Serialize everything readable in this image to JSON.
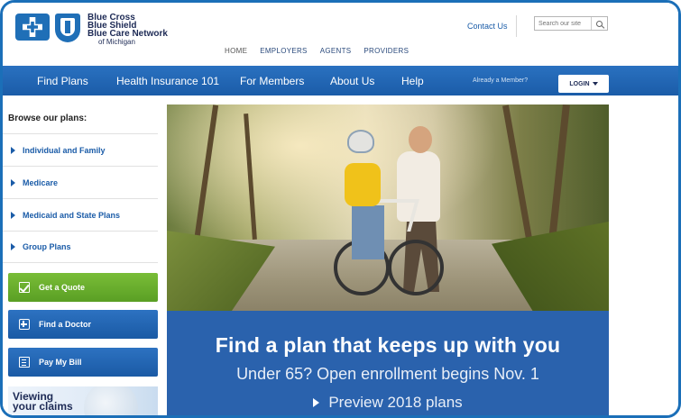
{
  "header": {
    "logo_lines": [
      "Blue Cross",
      "Blue Shield",
      "Blue Care Network"
    ],
    "logo_sub": "of Michigan",
    "contact_label": "Contact Us",
    "search_placeholder": "Search our site"
  },
  "topnav": [
    "HOME",
    "EMPLOYERS",
    "AGENTS",
    "PROVIDERS"
  ],
  "mainnav": {
    "items": [
      "Find Plans",
      "Health Insurance 101",
      "For Members",
      "About Us",
      "Help"
    ],
    "member_text": "Already a Member?",
    "login_label": "LOGIN"
  },
  "sidebar": {
    "title": "Browse our plans:",
    "items": [
      "Individual and Family",
      "Medicare",
      "Medicaid and State Plans",
      "Group Plans"
    ],
    "buttons": {
      "quote": "Get a Quote",
      "doctor": "Find a Doctor",
      "bill": "Pay My Bill"
    },
    "claims": [
      "Viewing",
      "your claims"
    ]
  },
  "hero": {
    "headline": "Find a plan that keeps up with you",
    "sub": "Under 65? Open enrollment begins Nov. 1",
    "cta": "Preview 2018 plans"
  },
  "colors": {
    "brand_blue": "#1b5ca8",
    "hero_band": "#2a62ad",
    "quote_green": "#6aaf2e",
    "frame": "#1b6fb8"
  },
  "icons": [
    "search-icon",
    "caret-down-icon",
    "checkbox-icon",
    "plus-icon",
    "bill-icon",
    "play-icon"
  ]
}
